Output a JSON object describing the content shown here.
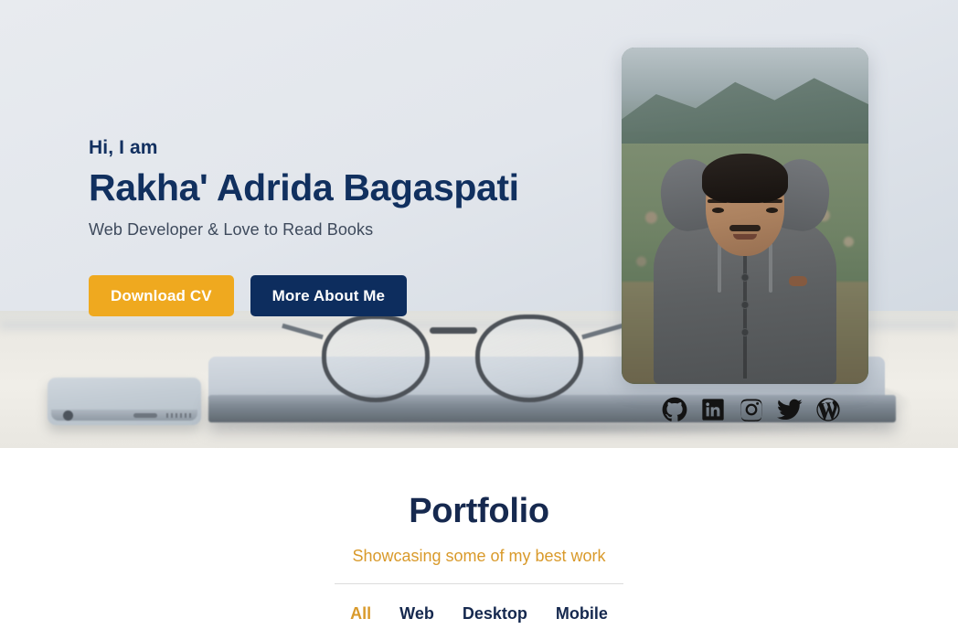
{
  "hero": {
    "greeting": "Hi, I am",
    "name": "Rakha' Adrida Bagaspati",
    "tagline": "Web Developer & Love to Read Books",
    "buttons": {
      "download_cv": "Download CV",
      "more_about": "More About Me"
    },
    "colors": {
      "amber": "#efa91f",
      "navy": "#0d2d5e",
      "tagline_gray": "#3e4a5c",
      "background": "#e3e7ec"
    },
    "portrait_alt": "profile-photo",
    "socials": [
      {
        "name": "github-icon",
        "label": "GitHub"
      },
      {
        "name": "linkedin-icon",
        "label": "LinkedIn"
      },
      {
        "name": "instagram-icon",
        "label": "Instagram"
      },
      {
        "name": "twitter-icon",
        "label": "Twitter"
      },
      {
        "name": "wordpress-icon",
        "label": "WordPress"
      }
    ]
  },
  "portfolio": {
    "title": "Portfolio",
    "subtitle": "Showcasing some of my best work",
    "filters": [
      {
        "label": "All",
        "active": true
      },
      {
        "label": "Web",
        "active": false
      },
      {
        "label": "Desktop",
        "active": false
      },
      {
        "label": "Mobile",
        "active": false
      }
    ],
    "colors": {
      "title": "#16294f",
      "subtitle": "#d99a2b",
      "active_filter": "#d99a2b"
    }
  }
}
